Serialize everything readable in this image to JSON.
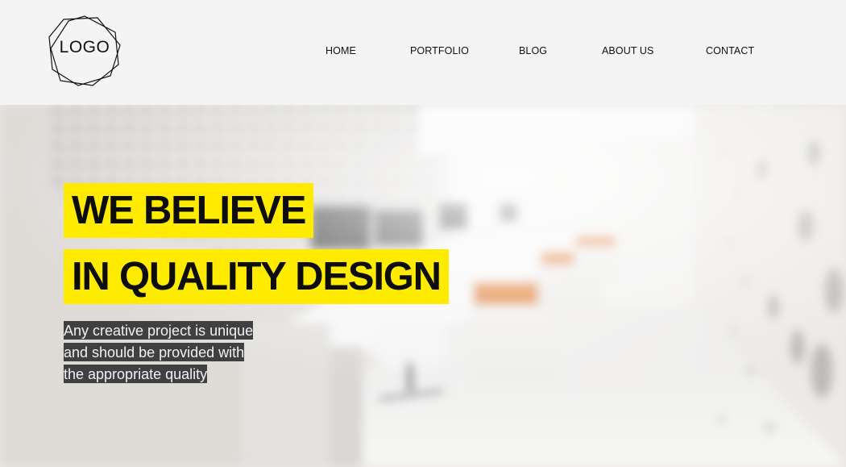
{
  "logo": {
    "text": "LOGO"
  },
  "nav": {
    "items": [
      {
        "label": "HOME"
      },
      {
        "label": "PORTFOLIO"
      },
      {
        "label": "BLOG"
      },
      {
        "label": "ABOUT US"
      },
      {
        "label": "CONTACT"
      }
    ]
  },
  "hero": {
    "headline": [
      "WE BELIEVE",
      "IN QUALITY DESIGN"
    ],
    "subtitle": [
      "Any creative project is unique",
      "and should be provided with",
      "the appropriate quality"
    ],
    "colors": {
      "highlight": "#ffeb00",
      "subtitle_bg": "#323234",
      "desk_accent": "#e07a2c"
    }
  }
}
